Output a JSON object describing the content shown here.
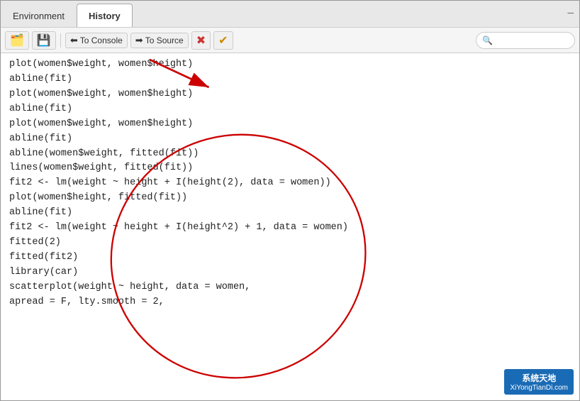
{
  "tabs": [
    {
      "id": "environment",
      "label": "Environment",
      "active": false
    },
    {
      "id": "history",
      "label": "History",
      "active": true
    }
  ],
  "toolbar": {
    "load_label": "Load",
    "save_label": "Save",
    "to_console_label": "To Console",
    "to_source_label": "To Source",
    "delete_label": "Delete",
    "run_label": "Run",
    "search_placeholder": ""
  },
  "code_lines": [
    "plot(women$weight, women$height)",
    "abline(fit)",
    "plot(women$weight, women$height)",
    "abline(fit)",
    "plot(women$weight, women$height)",
    "abline(fit)",
    "abline(women$weight, fitted(fit))",
    "lines(women$weight, fitted(fit))",
    "fit2 <- lm(weight ~ height + I(height(2), data = women))",
    "plot(women$height, fitted(fit))",
    "abline(fit)",
    "fit2 <- lm(weight ~ height + I(height^2) + 1, data = women)",
    "fitted(2)",
    "fitted(fit2)",
    "library(car)",
    "scatterplot(weight ~ height, data = women,",
    "apread = F, lty.smooth = 2,"
  ],
  "watermark": {
    "line1": "系统天地",
    "line2": "XiYongTianDi.com"
  },
  "annotation": {
    "arrow_color": "#cc0000"
  }
}
